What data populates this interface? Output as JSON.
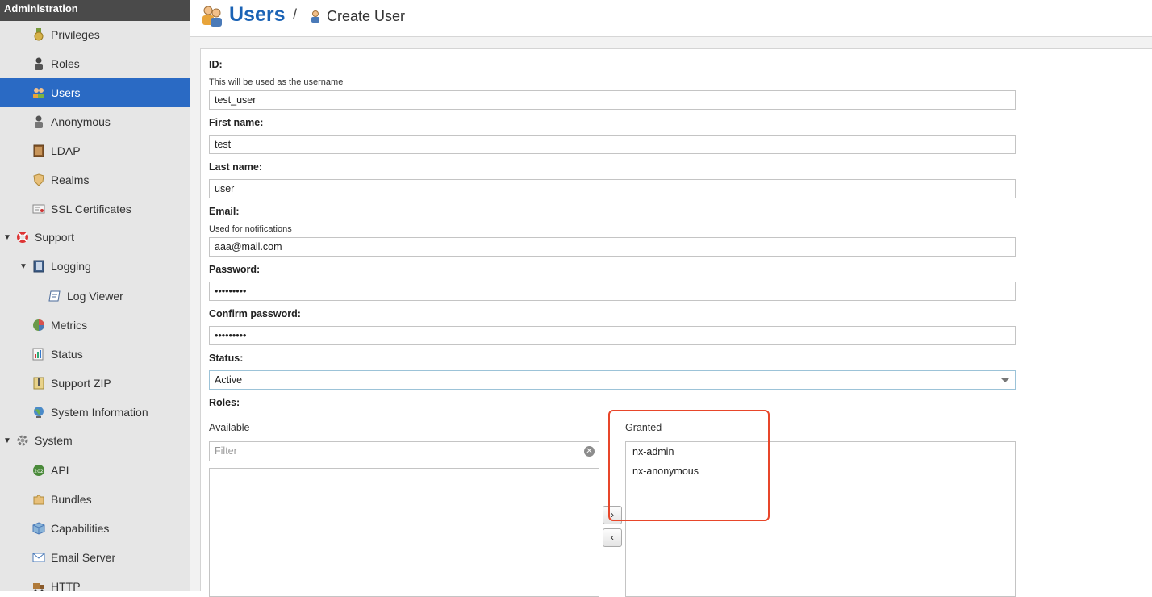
{
  "sidebar": {
    "title": "Administration",
    "items": [
      {
        "label": "Privileges",
        "icon": "medal-icon"
      },
      {
        "label": "Roles",
        "icon": "role-person-icon"
      },
      {
        "label": "Users",
        "icon": "users-icon",
        "selected": true
      },
      {
        "label": "Anonymous",
        "icon": "anonymous-icon"
      },
      {
        "label": "LDAP",
        "icon": "ldap-book-icon"
      },
      {
        "label": "Realms",
        "icon": "shield-icon"
      },
      {
        "label": "SSL Certificates",
        "icon": "certificate-icon"
      },
      {
        "label": "Support",
        "icon": "lifebuoy-icon",
        "expanded": true
      },
      {
        "label": "Logging",
        "icon": "log-book-icon",
        "expanded": true
      },
      {
        "label": "Log Viewer",
        "icon": "scroll-icon"
      },
      {
        "label": "Metrics",
        "icon": "pie-chart-icon"
      },
      {
        "label": "Status",
        "icon": "status-chart-icon"
      },
      {
        "label": "Support ZIP",
        "icon": "zip-icon"
      },
      {
        "label": "System Information",
        "icon": "globe-icon"
      },
      {
        "label": "System",
        "icon": "gear-icon",
        "expanded": true
      },
      {
        "label": "API",
        "icon": "api-badge-icon"
      },
      {
        "label": "Bundles",
        "icon": "puzzle-icon"
      },
      {
        "label": "Capabilities",
        "icon": "cube-icon"
      },
      {
        "label": "Email Server",
        "icon": "envelope-icon"
      },
      {
        "label": "HTTP",
        "icon": "truck-icon"
      }
    ]
  },
  "header": {
    "title": "Users",
    "separator": "/",
    "subtitle": "Create User"
  },
  "form": {
    "id": {
      "label": "ID:",
      "help": "This will be used as the username",
      "value": "test_user"
    },
    "first_name": {
      "label": "First name:",
      "value": "test"
    },
    "last_name": {
      "label": "Last name:",
      "value": "user"
    },
    "email": {
      "label": "Email:",
      "help": "Used for notifications",
      "value": "aaa@mail.com"
    },
    "password": {
      "label": "Password:",
      "value": "•••••••••"
    },
    "confirm_password": {
      "label": "Confirm password:",
      "value": "•••••••••"
    },
    "status": {
      "label": "Status:",
      "value": "Active"
    },
    "roles": {
      "label": "Roles:",
      "available_title": "Available",
      "filter_placeholder": "Filter",
      "granted_title": "Granted",
      "granted": [
        "nx-admin",
        "nx-anonymous"
      ],
      "move_right": "›",
      "move_left": "‹"
    }
  },
  "colors": {
    "accent": "#1b63b5",
    "selected_bg": "#2a6ac4",
    "highlight": "#e8462a"
  }
}
